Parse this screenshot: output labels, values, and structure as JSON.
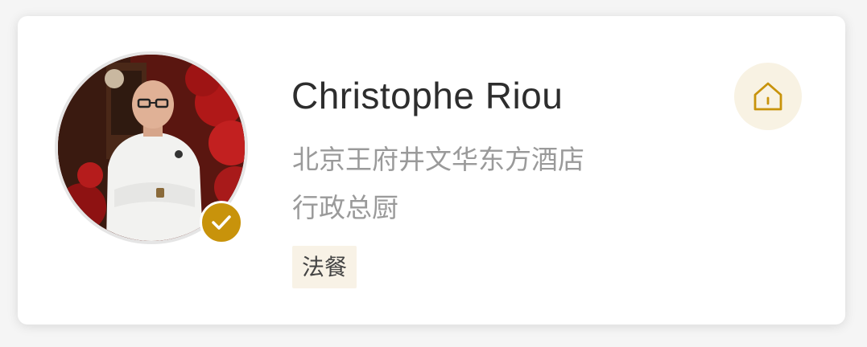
{
  "profile": {
    "name": "Christophe Riou",
    "hotel": "北京王府井文华东方酒店",
    "role": "行政总厨",
    "cuisine_tag": "法餐",
    "verified": true,
    "avatar_icon": "chef-photo",
    "action_icon": "home-icon"
  },
  "colors": {
    "accent_gold": "#c8930b",
    "tag_background": "#f8f2e6",
    "secondary_text": "#9a9a9a",
    "primary_text": "#2d2d2d"
  }
}
